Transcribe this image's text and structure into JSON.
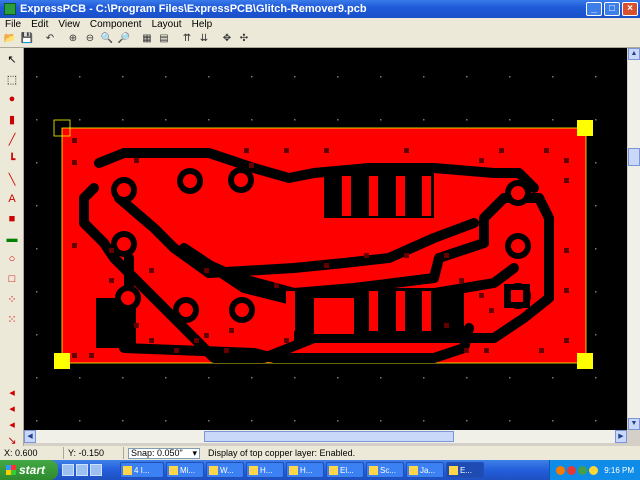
{
  "window": {
    "title": "ExpressPCB - C:\\Program Files\\ExpressPCB\\Glitch-Remover9.pcb"
  },
  "menu": [
    "File",
    "Edit",
    "View",
    "Component",
    "Layout",
    "Help"
  ],
  "toolbar": [
    {
      "name": "open-icon",
      "glyph": "📂"
    },
    {
      "name": "save-icon",
      "glyph": "💾"
    },
    {
      "name": "sep"
    },
    {
      "name": "undo-icon",
      "glyph": "↶"
    },
    {
      "name": "sep"
    },
    {
      "name": "zoom-in-icon",
      "glyph": "⊕"
    },
    {
      "name": "zoom-out-icon",
      "glyph": "⊖"
    },
    {
      "name": "zoom-fit-icon",
      "glyph": "🔍"
    },
    {
      "name": "zoom-window-icon",
      "glyph": "🔎"
    },
    {
      "name": "sep"
    },
    {
      "name": "layer-view-icon",
      "glyph": "▦"
    },
    {
      "name": "layer-swap-icon",
      "glyph": "▤"
    },
    {
      "name": "sep"
    },
    {
      "name": "flip-up-icon",
      "glyph": "⇈"
    },
    {
      "name": "flip-down-icon",
      "glyph": "⇊"
    },
    {
      "name": "sep"
    },
    {
      "name": "move-icon",
      "glyph": "✥"
    },
    {
      "name": "pan-icon",
      "glyph": "✣"
    }
  ],
  "left_tools": [
    {
      "name": "select-tool-icon",
      "glyph": "↖",
      "color": "#000000"
    },
    {
      "name": "rect-select-tool-icon",
      "glyph": "⬚",
      "color": "#000000"
    },
    {
      "name": "place-pad-tool-icon",
      "glyph": "●",
      "color": "#cc0000"
    },
    {
      "name": "place-component-tool-icon",
      "glyph": "▮",
      "color": "#cc0000"
    },
    {
      "name": "trace-tool-icon",
      "glyph": "╱",
      "color": "#cc0000"
    },
    {
      "name": "trace-corner-tool-icon",
      "glyph": "┗",
      "color": "#cc0000"
    },
    {
      "name": "diagonal-trace-tool-icon",
      "glyph": "╲",
      "color": "#cc0000"
    },
    {
      "name": "text-tool-icon",
      "glyph": "A",
      "color": "#cc0000"
    },
    {
      "name": "fill-tool-icon",
      "glyph": "■",
      "color": "#cc0000"
    },
    {
      "name": "green-layer-tool-icon",
      "glyph": "▬",
      "color": "#008000"
    },
    {
      "name": "circle-tool-icon",
      "glyph": "○",
      "color": "#cc0000"
    },
    {
      "name": "outline-tool-icon",
      "glyph": "□",
      "color": "#cc0000"
    },
    {
      "name": "via-tool-icon",
      "glyph": "⁘",
      "color": "#cc0000"
    },
    {
      "name": "grid-tool-icon",
      "glyph": "⁙",
      "color": "#cc0000"
    }
  ],
  "bottom_tools": [
    {
      "name": "top-layer-tool-icon",
      "glyph": "◂"
    },
    {
      "name": "bottom-layer-tool-icon",
      "glyph": "◂"
    },
    {
      "name": "silk-layer-tool-icon",
      "glyph": "◂"
    },
    {
      "name": "mirror-tool-icon",
      "glyph": "↘"
    }
  ],
  "status": {
    "x": "X:  0.600",
    "y": "Y:  -0.150",
    "snap": "Snap:  0.050\"",
    "message": "Display of top copper layer:  Enabled."
  },
  "taskbar": {
    "start_label": "start",
    "tasks": [
      "4 I...",
      "Mi...",
      "W...",
      "H...",
      "H...",
      "El...",
      "Sc...",
      "Ja...",
      "E..."
    ],
    "time": "9:16 PM"
  },
  "colors": {
    "copper": "#ff0000",
    "board_bg": "#000000",
    "corner_marker": "#ffff00"
  }
}
